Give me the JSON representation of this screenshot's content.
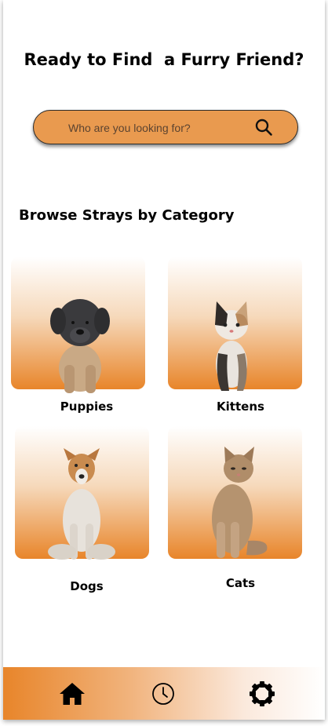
{
  "header": {
    "title": "Ready to Find  a Furry Friend?"
  },
  "search": {
    "placeholder": "Who are you looking for?",
    "icon": "search-icon"
  },
  "browse": {
    "title": "Browse Strays by Category",
    "categories": [
      {
        "label": "Puppies",
        "icon": "puppy-photo"
      },
      {
        "label": "Kittens",
        "icon": "kitten-photo"
      },
      {
        "label": "Dogs",
        "icon": "dog-photo"
      },
      {
        "label": "Cats",
        "icon": "cat-photo"
      }
    ]
  },
  "nav": {
    "items": [
      {
        "icon": "home-icon"
      },
      {
        "icon": "history-clock-icon"
      },
      {
        "icon": "settings-gear-icon"
      }
    ]
  },
  "colors": {
    "accent": "#e8852a",
    "search_bg": "#e99a4f"
  }
}
